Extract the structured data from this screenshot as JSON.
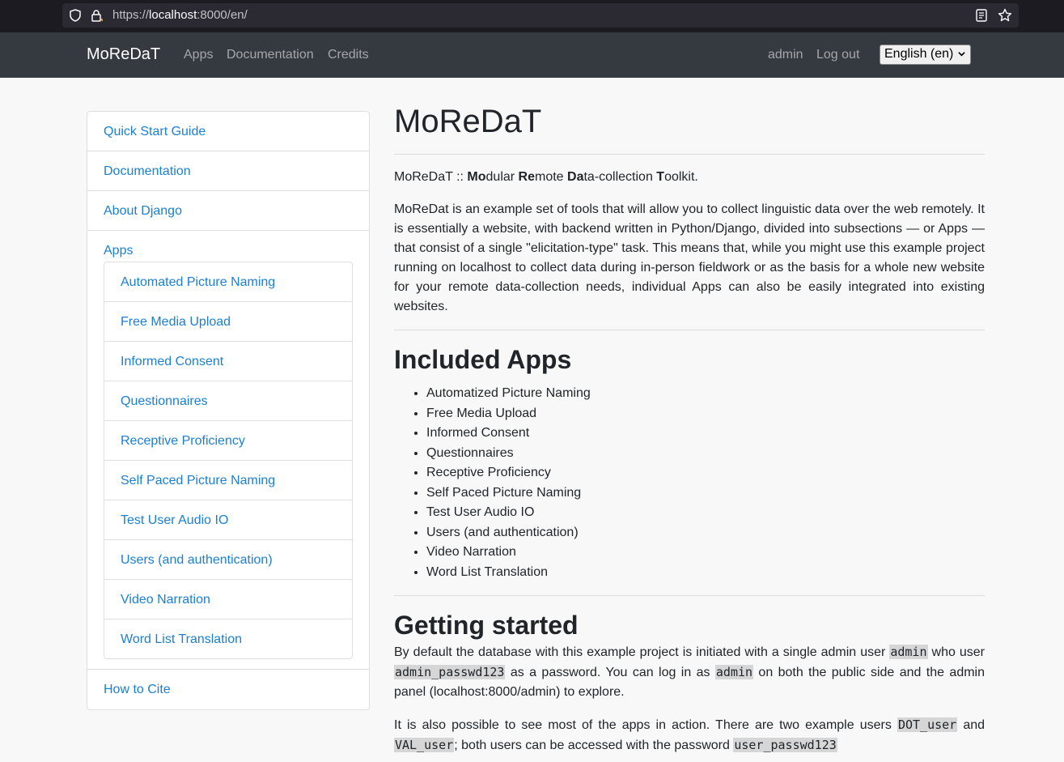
{
  "browser": {
    "url_prefix": "https://",
    "url_host": "localhost",
    "url_rest": ":8000/en/"
  },
  "navbar": {
    "brand": "MoReDaT",
    "links": [
      "Apps",
      "Documentation",
      "Credits"
    ],
    "user": "admin",
    "logout": "Log out",
    "language": "English (en)"
  },
  "sidebar": {
    "items_top": [
      "Quick Start Guide",
      "Documentation",
      "About Django"
    ],
    "apps_label": "Apps",
    "apps": [
      "Automated Picture Naming",
      "Free Media Upload",
      "Informed Consent",
      "Questionnaires",
      "Receptive Proficiency",
      "Self Paced Picture Naming",
      "Test User Audio IO",
      "Users (and authentication)",
      "Video Narration",
      "Word List Translation"
    ],
    "cite": "How to Cite"
  },
  "main": {
    "title": "MoReDaT",
    "tagline": {
      "prefix": "MoReDaT :: ",
      "p1b": "Mo",
      "p1": "dular ",
      "p2b": "Re",
      "p2": "mote ",
      "p3b": "Da",
      "p3": "ta-collection ",
      "p4b": "T",
      "p4": "oolkit."
    },
    "intro": "MoReDat is an example set of tools that will allow you to collect linguistic data over the web remotely. It is essentially a website, with backend written in Python/Django, divided into subsections — or Apps — that consist of a single \"elicitation-type\" task. This means that, while you might use this example project running on localhost to collect data during in-person fieldwork or as the basis for a whole new website for your remote data-collection needs, individual Apps can also be easily integrated into existing websites.",
    "included_heading": "Included Apps",
    "included_apps": [
      "Automatized Picture Naming",
      "Free Media Upload",
      "Informed Consent",
      "Questionnaires",
      "Receptive Proficiency",
      "Self Paced Picture Naming",
      "Test User Audio IO",
      "Users (and authentication)",
      "Video Narration",
      "Word List Translation"
    ],
    "getting_heading": "Getting started",
    "gs1": {
      "t1": "By default the database with this example project is initiated with a single admin user ",
      "c1": "admin",
      "t2": " who user ",
      "c2": "admin_passwd123",
      "t3": " as a password. You can log in as ",
      "c3": "admin",
      "t4": " on both the public side and the admin panel (localhost:8000/admin) to explore."
    },
    "gs2": {
      "t1": "It is also possible to see most of the apps in action. There are two example users ",
      "c1": "DOT_user",
      "t2": " and ",
      "c2": "VAL_user",
      "t3": "; both users can be accessed with the password ",
      "c3": "user_passwd123"
    }
  }
}
